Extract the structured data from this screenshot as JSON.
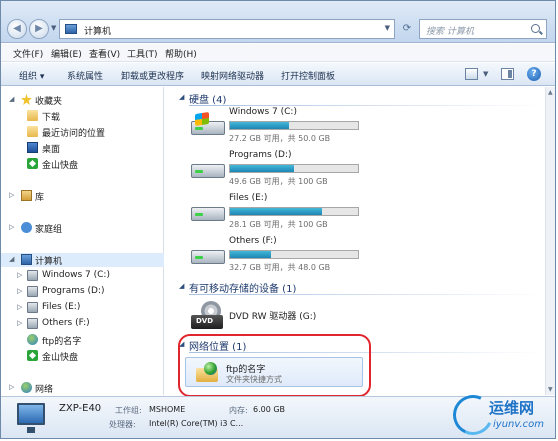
{
  "address": {
    "path": "计算机",
    "search_placeholder": "搜索 计算机"
  },
  "menu": [
    "文件(F)",
    "编辑(E)",
    "查看(V)",
    "工具(T)",
    "帮助(H)"
  ],
  "toolbar": [
    "组织",
    "系统属性",
    "卸载或更改程序",
    "映射网络驱动器",
    "打开控制面板"
  ],
  "navpane": {
    "favorites": {
      "label": "收藏夹",
      "items": [
        "下载",
        "最近访问的位置",
        "桌面",
        "金山快盘"
      ]
    },
    "library": "库",
    "homegroup": "家庭组",
    "computer": {
      "label": "计算机",
      "items": [
        "Windows 7 (C:)",
        "Programs (D:)",
        "Files (E:)",
        "Others (F:)",
        "ftp的名字",
        "金山快盘"
      ]
    },
    "network": "网络"
  },
  "groups": {
    "hdd": "硬盘 (4)",
    "removable": "有可移动存储的设备 (1)",
    "network": "网络位置 (1)"
  },
  "drives": [
    {
      "name": "Windows 7 (C:)",
      "info": "27.2 GB 可用，共 50.0 GB",
      "used_fraction": 0.46
    },
    {
      "name": "Programs (D:)",
      "info": "49.6 GB 可用，共 100 GB",
      "used_fraction": 0.5
    },
    {
      "name": "Files (E:)",
      "info": "28.1 GB 可用，共 100 GB",
      "used_fraction": 0.72
    },
    {
      "name": "Others (F:)",
      "info": "32.7 GB 可用，共 48.0 GB",
      "used_fraction": 0.32
    }
  ],
  "dvd": {
    "name": "DVD RW 驱动器 (G:)",
    "badge": "DVD"
  },
  "netloc": {
    "name": "ftp的名字",
    "type": "文件夹快捷方式"
  },
  "details": {
    "name": "ZXP-E40",
    "workgroup_label": "工作组:",
    "workgroup_value": "MSHOME",
    "memory_label": "内存:",
    "memory_value": "6.00 GB",
    "processor_label": "处理器:",
    "processor_value": "Intel(R) Core(TM) i3 C..."
  },
  "watermark": {
    "cn": "运维网",
    "url": "iyunv.com"
  },
  "colors": {
    "bar_fill": "#1c86b4",
    "highlight": "#e0262c",
    "group_title": "#1e3a6e"
  }
}
